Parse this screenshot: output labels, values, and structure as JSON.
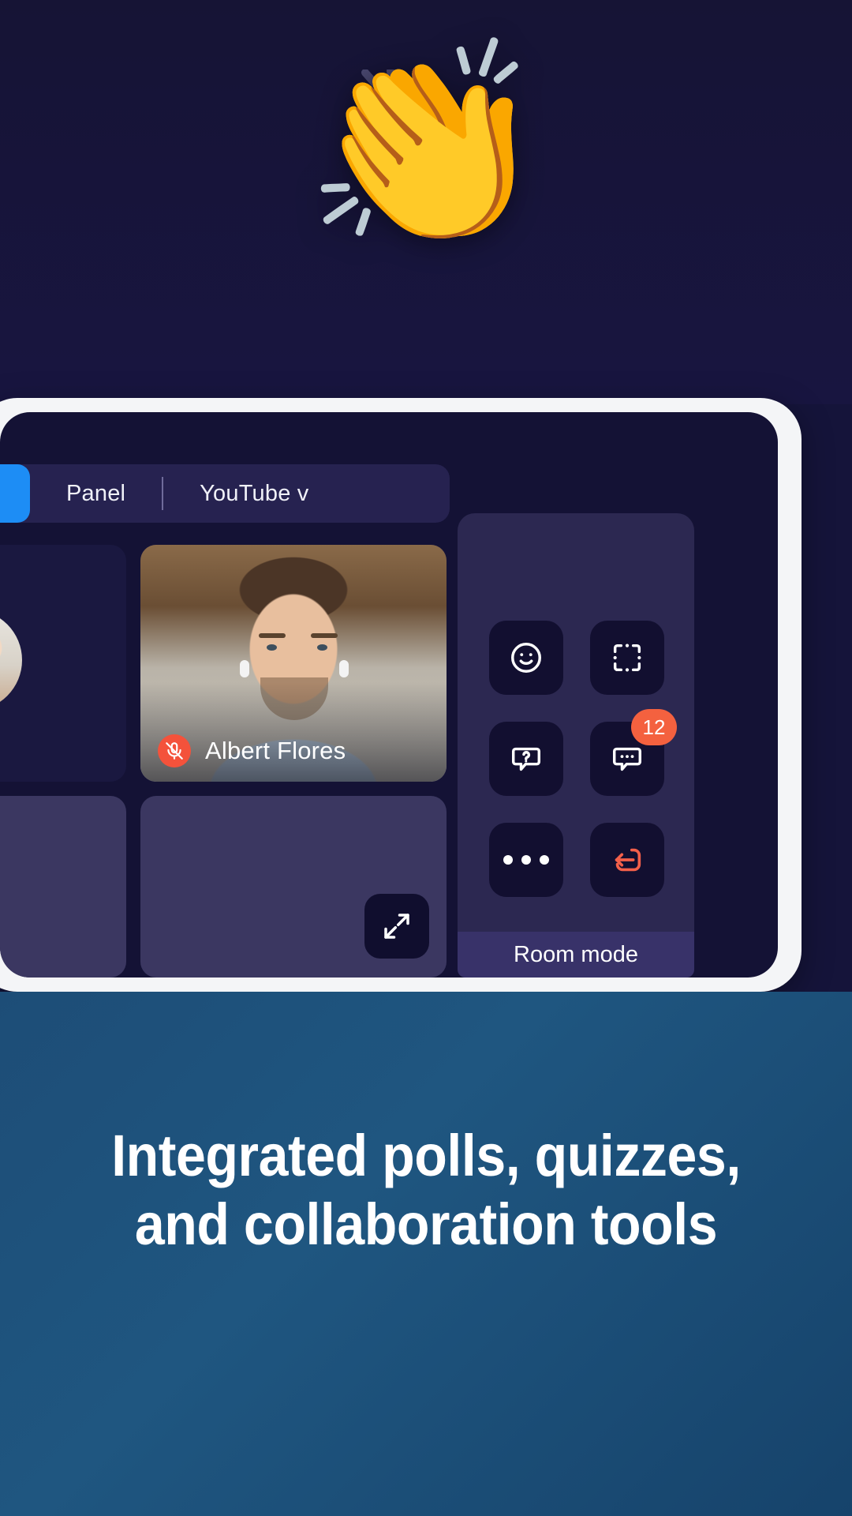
{
  "hero": {
    "emoji": "👏",
    "emoji_name": "clapping-hands"
  },
  "app": {
    "tabs": [
      {
        "label": "",
        "name": "tab-color-chip"
      },
      {
        "label": "Panel",
        "name": "tab-panel"
      },
      {
        "label": "YouTube v",
        "name": "tab-youtube-video"
      }
    ],
    "participants": [
      {
        "name": "",
        "muted": true
      },
      {
        "name": "Albert Flores",
        "muted": true
      }
    ],
    "name_label": "Albert Flores",
    "side_panel": {
      "raise_hand_emoji": "✋",
      "raise_hand_name": "raise-hand-button",
      "actions": [
        {
          "name": "reactions-button",
          "icon": "smiley-icon",
          "badge": null
        },
        {
          "name": "whiteboard-button",
          "icon": "frame-icon",
          "badge": null
        },
        {
          "name": "quiz-button",
          "icon": "question-bubble-icon",
          "badge": null
        },
        {
          "name": "chat-button",
          "icon": "chat-bubble-icon",
          "badge": "12"
        },
        {
          "name": "more-options-button",
          "icon": "ellipsis-icon",
          "badge": null
        },
        {
          "name": "leave-room-button",
          "icon": "exit-icon",
          "badge": null
        }
      ],
      "room_mode_label": "Room mode"
    },
    "self_view": {
      "controls": [
        {
          "name": "camera-toggle-button",
          "icon": "video-camera-icon",
          "state": "on"
        },
        {
          "name": "speaker-toggle-button",
          "icon": "speaker-icon",
          "state": "on"
        },
        {
          "name": "microphone-toggle-button",
          "icon": "microphone-muted-icon",
          "state": "muted"
        }
      ],
      "drum_emoji": "🥁",
      "drum_name": "drum-reaction-button"
    },
    "expand_button_name": "expand-video-button"
  },
  "promo": {
    "line1": "Integrated polls, quizzes,",
    "line2": "and collaboration tools"
  },
  "colors": {
    "accent_yellow": "#f5c828",
    "accent_blue": "#1d8df5",
    "badge_orange": "#f4613f",
    "danger_red": "#f4523b",
    "panel_bg": "#2c2851",
    "app_bg": "#141235",
    "promo_bg": "#1f5680"
  }
}
